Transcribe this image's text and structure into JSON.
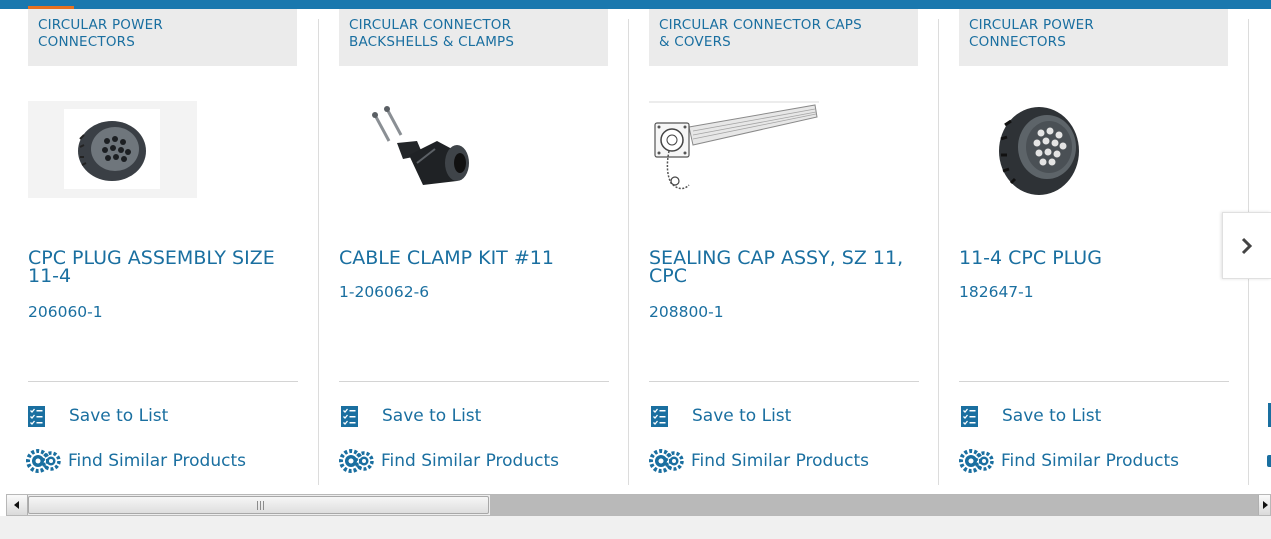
{
  "colors": {
    "link": "#1a6fa0",
    "accent": "#e8711f",
    "brand_bar": "#1a78ae",
    "category_bg": "#ebebeb"
  },
  "products": [
    {
      "category_lines": [
        "CIRCULAR POWER",
        "CONNECTORS"
      ],
      "title": "CPC PLUG ASSEMBLY SIZE 11-4",
      "part_number": "206060-1",
      "image_icon": "circular-plug-image"
    },
    {
      "category_lines": [
        "CIRCULAR CONNECTOR",
        "BACKSHELLS & CLAMPS"
      ],
      "title": "CABLE CLAMP KIT #11",
      "part_number": "1-206062-6",
      "image_icon": "cable-clamp-image"
    },
    {
      "category_lines": [
        "CIRCULAR CONNECTOR CAPS",
        "& COVERS"
      ],
      "title": "SEALING CAP ASSY, SZ 11, CPC",
      "part_number": "208800-1",
      "image_icon": "sealing-cap-image"
    },
    {
      "category_lines": [
        "CIRCULAR POWER",
        "CONNECTORS"
      ],
      "title": "11-4 CPC PLUG",
      "part_number": "182647-1",
      "image_icon": "circular-plug-image"
    }
  ],
  "actions": {
    "save_label": "Save to List",
    "similar_label": "Find Similar Products",
    "save_icon": "checklist-icon",
    "similar_icon": "gears-icon"
  },
  "carousel": {
    "next_icon": "chevron-right-icon"
  },
  "scrollbar": {
    "left_icon": "arrow-left-icon",
    "right_icon": "arrow-right-icon",
    "grip_icon": "grip-icon"
  }
}
